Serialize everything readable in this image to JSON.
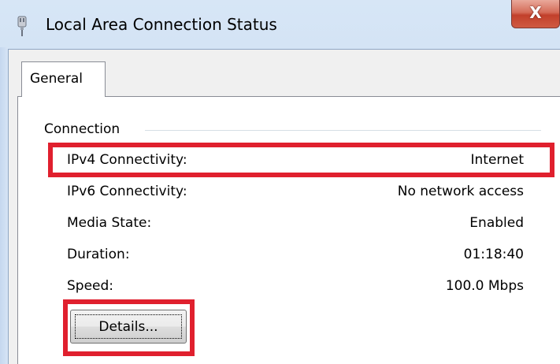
{
  "window": {
    "title": "Local Area Connection Status",
    "close_glyph": "X",
    "icon": "network-cable-icon"
  },
  "tabs": [
    {
      "label": "General",
      "selected": true
    }
  ],
  "connection": {
    "group_label": "Connection",
    "rows": [
      {
        "label": "IPv4 Connectivity:",
        "value": "Internet"
      },
      {
        "label": "IPv6 Connectivity:",
        "value": "No network access"
      },
      {
        "label": "Media State:",
        "value": "Enabled"
      },
      {
        "label": "Duration:",
        "value": "01:18:40"
      },
      {
        "label": "Speed:",
        "value": "100.0 Mbps"
      }
    ]
  },
  "buttons": {
    "details_label": "Details..."
  },
  "colors": {
    "highlight": "#e0202e",
    "close_button": "#c2402b"
  }
}
